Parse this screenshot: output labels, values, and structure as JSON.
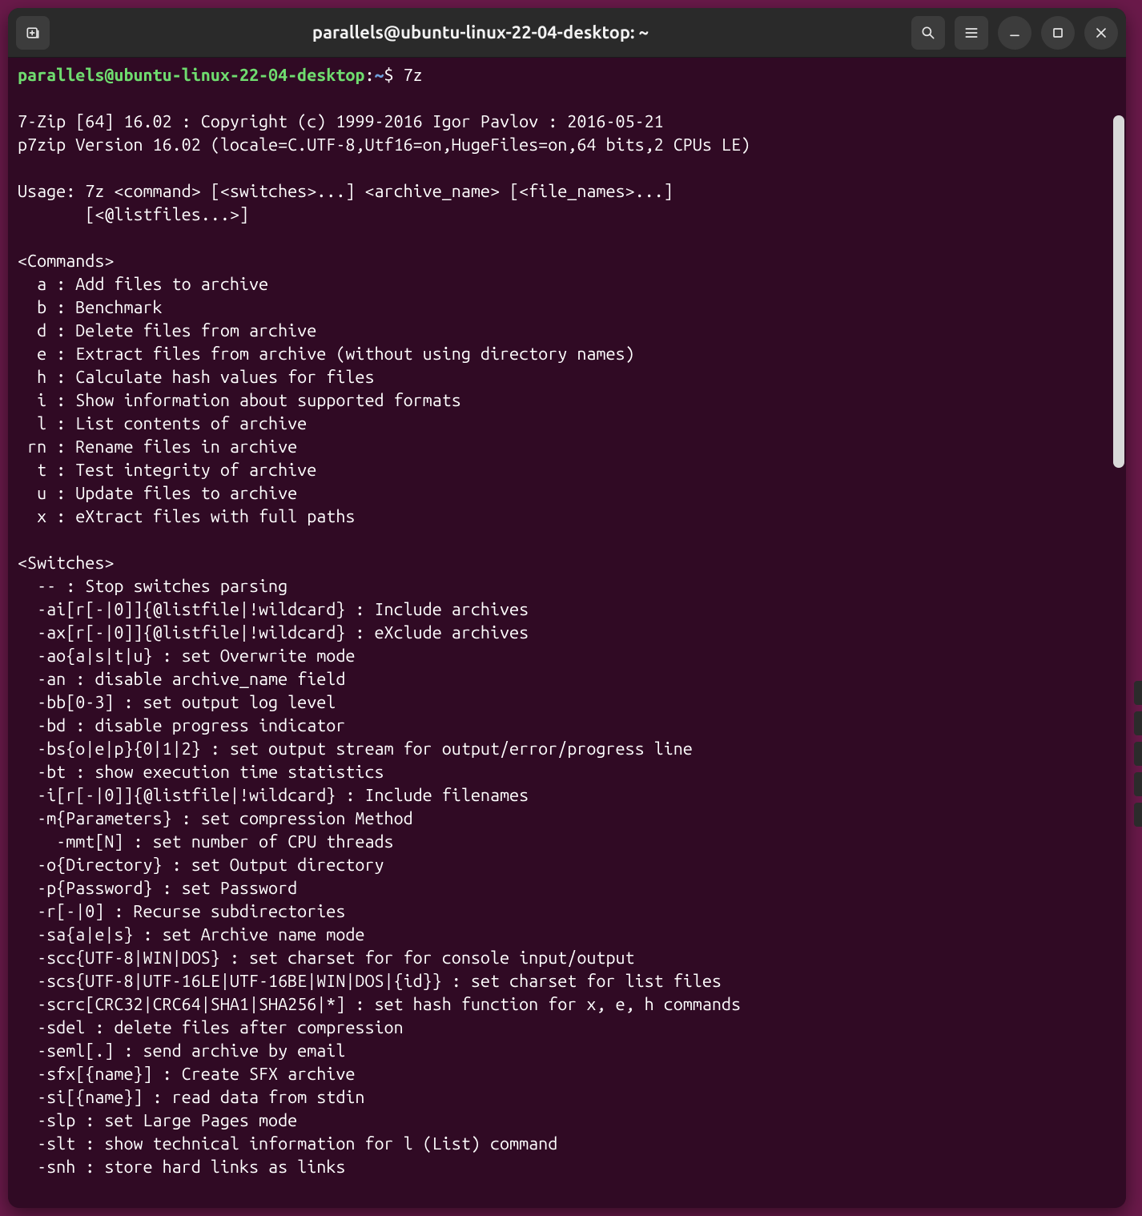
{
  "window": {
    "title": "parallels@ubuntu-linux-22-04-desktop: ~"
  },
  "prompt": {
    "user_host": "parallels@ubuntu-linux-22-04-desktop",
    "sep1": ":",
    "path": "~",
    "sep2": "$",
    "command": "7z"
  },
  "output": {
    "header1": "7-Zip [64] 16.02 : Copyright (c) 1999-2016 Igor Pavlov : 2016-05-21",
    "header2": "p7zip Version 16.02 (locale=C.UTF-8,Utf16=on,HugeFiles=on,64 bits,2 CPUs LE)",
    "usage1": "Usage: 7z <command> [<switches>...] <archive_name> [<file_names>...]",
    "usage2": "       [<@listfiles...>]",
    "commands_header": "<Commands>",
    "commands": [
      "  a : Add files to archive",
      "  b : Benchmark",
      "  d : Delete files from archive",
      "  e : Extract files from archive (without using directory names)",
      "  h : Calculate hash values for files",
      "  i : Show information about supported formats",
      "  l : List contents of archive",
      " rn : Rename files in archive",
      "  t : Test integrity of archive",
      "  u : Update files to archive",
      "  x : eXtract files with full paths"
    ],
    "switches_header": "<Switches>",
    "switches": [
      "  -- : Stop switches parsing",
      "  -ai[r[-|0]]{@listfile|!wildcard} : Include archives",
      "  -ax[r[-|0]]{@listfile|!wildcard} : eXclude archives",
      "  -ao{a|s|t|u} : set Overwrite mode",
      "  -an : disable archive_name field",
      "  -bb[0-3] : set output log level",
      "  -bd : disable progress indicator",
      "  -bs{o|e|p}{0|1|2} : set output stream for output/error/progress line",
      "  -bt : show execution time statistics",
      "  -i[r[-|0]]{@listfile|!wildcard} : Include filenames",
      "  -m{Parameters} : set compression Method",
      "    -mmt[N] : set number of CPU threads",
      "  -o{Directory} : set Output directory",
      "  -p{Password} : set Password",
      "  -r[-|0] : Recurse subdirectories",
      "  -sa{a|e|s} : set Archive name mode",
      "  -scc{UTF-8|WIN|DOS} : set charset for for console input/output",
      "  -scs{UTF-8|UTF-16LE|UTF-16BE|WIN|DOS|{id}} : set charset for list files",
      "  -scrc[CRC32|CRC64|SHA1|SHA256|*] : set hash function for x, e, h commands",
      "  -sdel : delete files after compression",
      "  -seml[.] : send archive by email",
      "  -sfx[{name}] : Create SFX archive",
      "  -si[{name}] : read data from stdin",
      "  -slp : set Large Pages mode",
      "  -slt : show technical information for l (List) command",
      "  -snh : store hard links as links"
    ]
  }
}
